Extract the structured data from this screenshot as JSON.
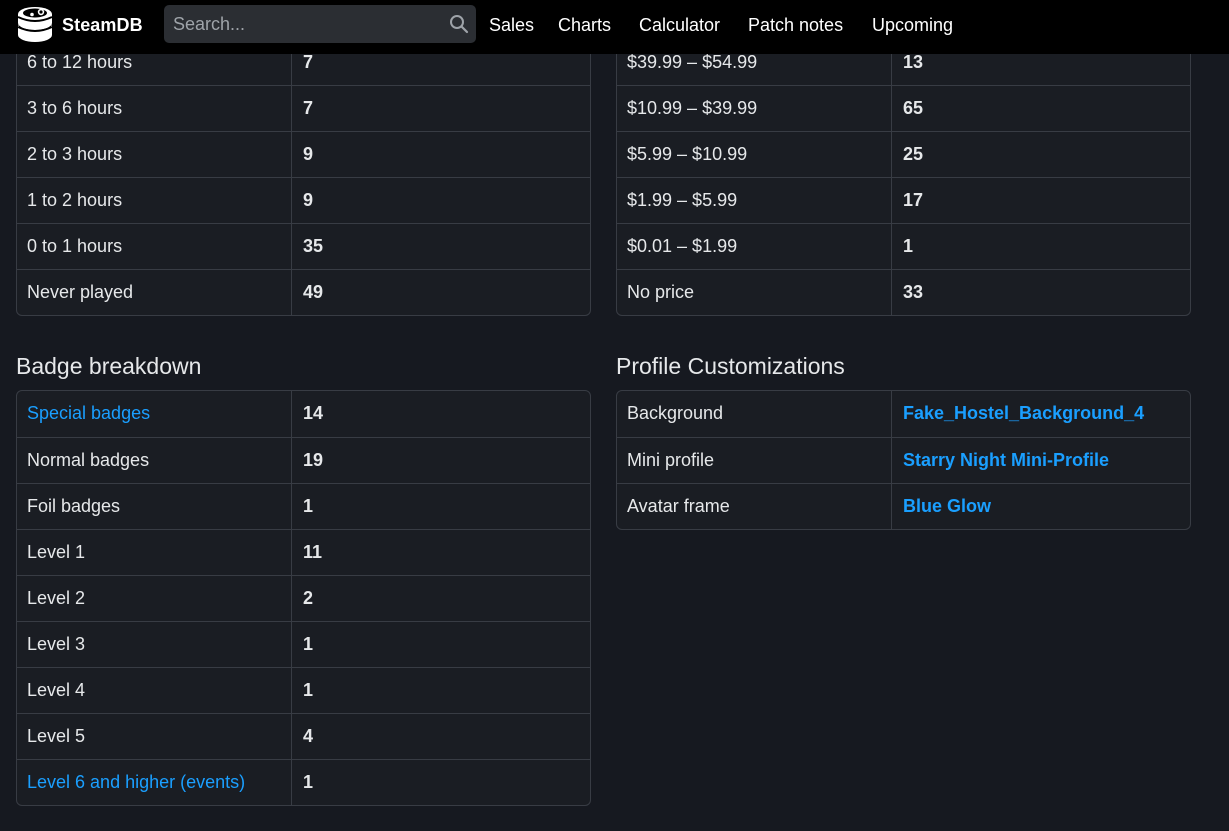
{
  "header": {
    "brand": "SteamDB",
    "search_placeholder": "Search...",
    "nav": [
      "Sales",
      "Charts",
      "Calculator",
      "Patch notes",
      "Upcoming"
    ]
  },
  "playtime_table": {
    "rows": [
      {
        "label": "6 to 12 hours",
        "value": "7"
      },
      {
        "label": "3 to 6 hours",
        "value": "7"
      },
      {
        "label": "2 to 3 hours",
        "value": "9"
      },
      {
        "label": "1 to 2 hours",
        "value": "9"
      },
      {
        "label": "0 to 1 hours",
        "value": "35"
      },
      {
        "label": "Never played",
        "value": "49"
      }
    ]
  },
  "price_table": {
    "rows": [
      {
        "label": "$39.99 – $54.99",
        "value": "13"
      },
      {
        "label": "$10.99 – $39.99",
        "value": "65"
      },
      {
        "label": "$5.99 – $10.99",
        "value": "25"
      },
      {
        "label": "$1.99 – $5.99",
        "value": "17"
      },
      {
        "label": "$0.01 – $1.99",
        "value": "1"
      },
      {
        "label": "No price",
        "value": "33"
      }
    ]
  },
  "badges": {
    "title": "Badge breakdown",
    "rows": [
      {
        "label": "Special badges",
        "value": "14",
        "link": true
      },
      {
        "label": "Normal badges",
        "value": "19"
      },
      {
        "label": "Foil badges",
        "value": "1"
      },
      {
        "label": "Level 1",
        "value": "11"
      },
      {
        "label": "Level 2",
        "value": "2"
      },
      {
        "label": "Level 3",
        "value": "1"
      },
      {
        "label": "Level 4",
        "value": "1"
      },
      {
        "label": "Level 5",
        "value": "4"
      },
      {
        "label": "Level 6 and higher (events)",
        "value": "1",
        "link": true
      }
    ]
  },
  "customizations": {
    "title": "Profile Customizations",
    "rows": [
      {
        "label": "Background",
        "value": "Fake_Hostel_Background_4"
      },
      {
        "label": "Mini profile",
        "value": "Starry Night Mini-Profile"
      },
      {
        "label": "Avatar frame",
        "value": "Blue Glow"
      }
    ]
  },
  "colors": {
    "background": "#161920",
    "table_background": "#1a1d23",
    "border": "#383c44",
    "link": "#1a9fff",
    "text": "#e6e8ea",
    "topbar": "#000000",
    "search_background": "#2b2e33"
  },
  "icons": {
    "logo": "steamdb-logo-icon",
    "search": "search-icon"
  }
}
